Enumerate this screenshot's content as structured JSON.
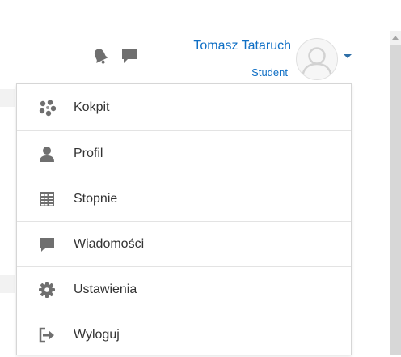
{
  "header": {
    "user_name": "Tomasz Tataruch",
    "user_role": "Student",
    "notification_icon": "bell-icon",
    "messages_icon": "chat-icon",
    "avatar_icon": "avatar-placeholder",
    "caret_icon": "caret-down-icon",
    "link_color": "#0f6fc5"
  },
  "menu": {
    "items": [
      {
        "label": "Kokpit",
        "icon": "dashboard-icon"
      },
      {
        "label": "Profil",
        "icon": "user-icon"
      },
      {
        "label": "Stopnie",
        "icon": "grades-table-icon"
      },
      {
        "label": "Wiadomości",
        "icon": "chat-icon"
      },
      {
        "label": "Ustawienia",
        "icon": "cog-icon"
      },
      {
        "label": "Wyloguj",
        "icon": "sign-out-icon"
      }
    ]
  }
}
